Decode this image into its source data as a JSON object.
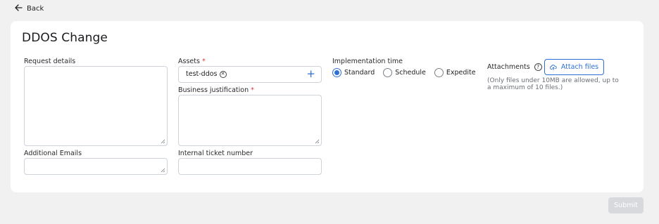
{
  "nav": {
    "back_label": "Back"
  },
  "form": {
    "title": "DDOS Change",
    "request_details": {
      "label": "Request details",
      "value": ""
    },
    "additional_emails": {
      "label": "Additional Emails",
      "value": ""
    },
    "assets": {
      "label": "Assets",
      "required_mark": "*",
      "chips": [
        "test-ddos"
      ]
    },
    "business_justification": {
      "label": "Business justification",
      "required_mark": "*",
      "value": ""
    },
    "internal_ticket": {
      "label": "Internal ticket number",
      "value": ""
    },
    "implementation_time": {
      "label": "Implementation time",
      "options": [
        "Standard",
        "Schedule",
        "Expedite"
      ],
      "selected": "Standard"
    },
    "attachments": {
      "label": "Attachments",
      "button_label": "Attach files",
      "note": "(Only files under 10MB are allowed, up to a maximum of 10 files.)"
    }
  },
  "footer": {
    "submit_label": "Submit",
    "submit_disabled": true
  },
  "colors": {
    "accent": "#2c6fd6",
    "required": "#d23a3a",
    "page_bg": "#f1f1f2"
  }
}
